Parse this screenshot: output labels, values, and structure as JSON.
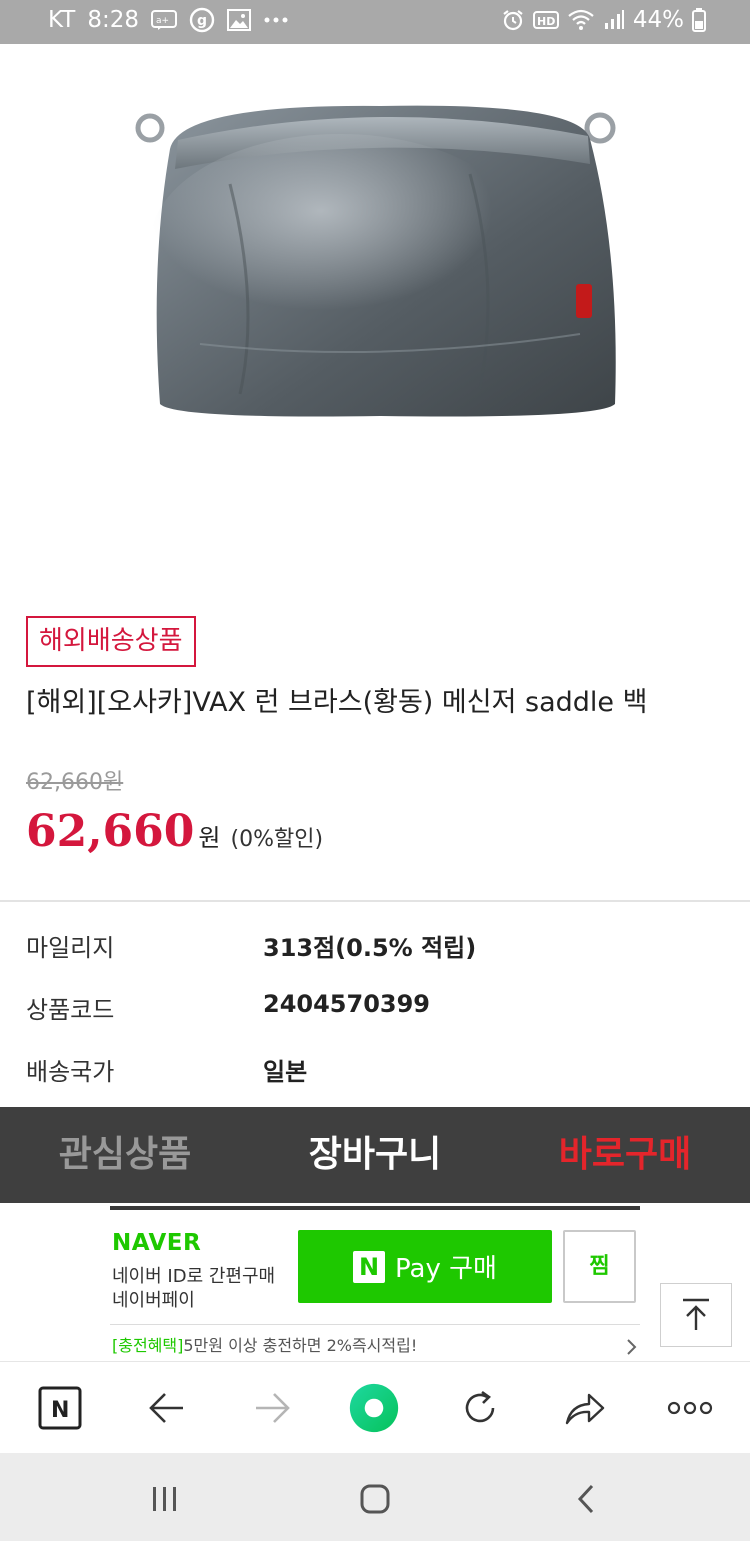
{
  "status_bar": {
    "carrier": "KT",
    "time": "8:28",
    "battery": "44%",
    "left_icons": [
      "message-icon",
      "g-icon",
      "gallery-icon",
      "more-dots-icon"
    ],
    "right_icons": [
      "alarm-icon",
      "hd-icon",
      "wifi-icon",
      "signal-icon",
      "battery-icon"
    ]
  },
  "product": {
    "badge": "해외배송상품",
    "title": "[해외][오사카]VAX 런 브라스(황동) 메신저 saddle 백",
    "original_price": "62,660원",
    "sale_price": "62,660",
    "sale_unit": "원",
    "discount": "(0%할인)"
  },
  "details": [
    {
      "label": "마일리지",
      "value": "313점(0.5% 적립)"
    },
    {
      "label": "상품코드",
      "value": "2404570399"
    },
    {
      "label": "배송국가",
      "value": "일본"
    }
  ],
  "actions": {
    "wishlist": "관심상품",
    "cart": "장바구니",
    "buy_now": "바로구매"
  },
  "naver_pay": {
    "logo": "NAVER",
    "sub1": "네이버 ID로 간편구매",
    "sub2": "네이버페이",
    "pay_n": "N",
    "pay_label": "Pay 구매",
    "zzim": "찜",
    "promo_highlight": "[충전혜택]",
    "promo_text": "5만원 이상 충전하면 2%즉시적립!"
  },
  "browser_toolbar": {
    "home_letter": "N",
    "buttons": [
      "naver-home-icon",
      "back-arrow-icon",
      "forward-arrow-icon",
      "green-dot-icon",
      "refresh-icon",
      "share-icon",
      "more-icon"
    ]
  },
  "colors": {
    "accent_red": "#d4173d",
    "naver_green": "#1ec800",
    "action_bar_bg": "#3f3f3f",
    "buy_red": "#e4252b"
  }
}
